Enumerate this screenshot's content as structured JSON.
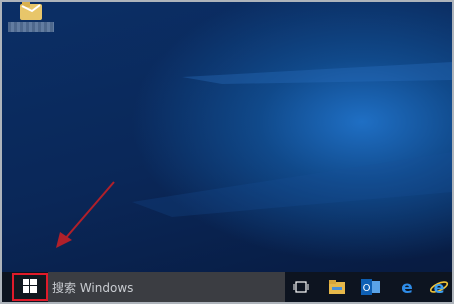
{
  "taskbar": {
    "search_placeholder": "搜索 Windows",
    "pinned": [
      {
        "name": "task-view-icon"
      },
      {
        "name": "file-explorer-icon"
      },
      {
        "name": "outlook-icon"
      },
      {
        "name": "edge-icon"
      },
      {
        "name": "internet-explorer-icon"
      }
    ]
  },
  "colors": {
    "highlight": "#e01b2a",
    "arrow": "#b0202a",
    "taskbar": "#0d1420",
    "search_box": "#3b3d42"
  }
}
